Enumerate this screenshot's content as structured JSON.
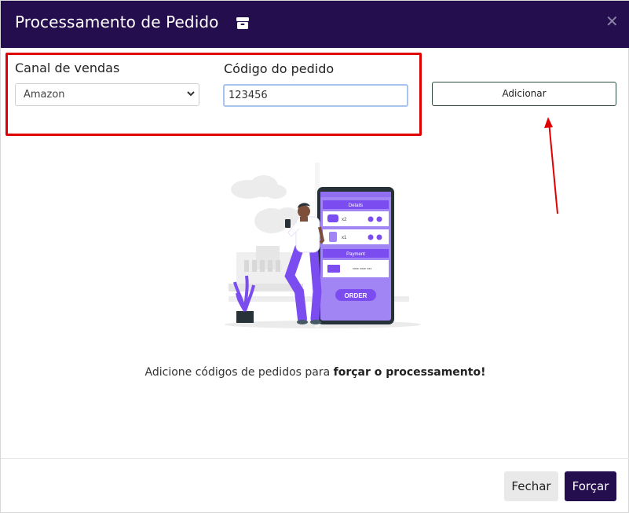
{
  "modal": {
    "title": "Processamento de Pedido",
    "title_icon": "box-icon",
    "close_icon": "close-icon"
  },
  "form": {
    "channel_label": "Canal de vendas",
    "channel_value": "Amazon",
    "order_label": "Código do pedido",
    "order_value": "123456",
    "add_label": "Adicionar"
  },
  "illustration": {
    "details_label": "Details",
    "qty1": "x2",
    "qty2": "x1",
    "payment_label": "Payment",
    "card_number": "**** **** ***",
    "order_button": "ORDER"
  },
  "hint": {
    "prefix": "Adicione códigos de pedidos para ",
    "bold": "forçar o processamento!"
  },
  "footer": {
    "close_label": "Fechar",
    "force_label": "Forçar"
  },
  "colors": {
    "header": "#240e4d",
    "accent_purple": "#7b4cf0",
    "annotation_red": "#e00000"
  }
}
